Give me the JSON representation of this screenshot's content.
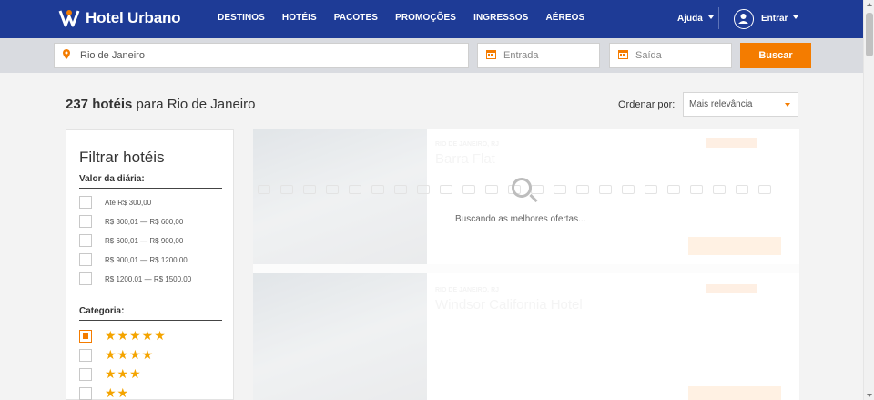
{
  "header": {
    "logo": "Hotel Urbano",
    "nav": [
      "DESTINOS",
      "HOTÉIS",
      "PACOTES",
      "PROMOÇÕES",
      "INGRESSOS",
      "AÉREOS"
    ],
    "help": "Ajuda",
    "login": "Entrar"
  },
  "search": {
    "destination": "Rio de Janeiro",
    "checkin_placeholder": "Entrada",
    "checkout_placeholder": "Saída",
    "button": "Buscar"
  },
  "results": {
    "count": "237 hotéis",
    "suffix": "para Rio de Janeiro",
    "order_label": "Ordenar por:",
    "order_value": "Mais relevância",
    "loading_text": "Buscando as melhores ofertas...",
    "cards": [
      {
        "location": "RIO DE JANEIRO, RJ",
        "name": "Barra Flat"
      },
      {
        "location": "RIO DE JANEIRO, RJ",
        "name": "Windsor California Hotel"
      }
    ]
  },
  "filters": {
    "title": "Filtrar hotéis",
    "price_section": "Valor da diária:",
    "price_options": [
      "Até R$ 300,00",
      "R$ 300,01 — R$ 600,00",
      "R$ 600,01 — R$ 900,00",
      "R$ 900,01 — R$ 1200,00",
      "R$ 1200,01 — R$ 1500,00"
    ],
    "category_section": "Categoria:",
    "category_options": [
      "★★★★★",
      "★★★★",
      "★★★",
      "★★"
    ]
  },
  "colors": {
    "brand": "#1e3b96",
    "accent": "#f47c00"
  }
}
